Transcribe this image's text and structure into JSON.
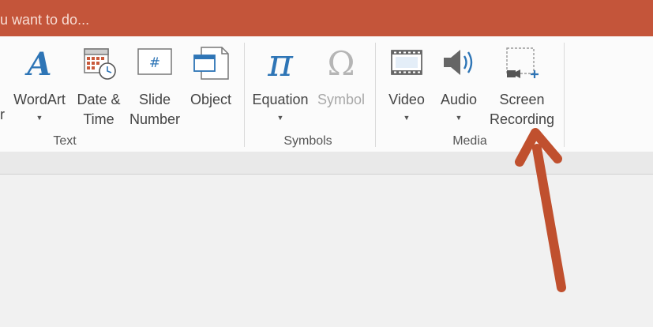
{
  "titlebar": {
    "tell_me": "u want to do..."
  },
  "ribbon": {
    "partial_label": "r",
    "buttons": {
      "wordart": {
        "label": "WordArt"
      },
      "datetime": {
        "line1": "Date &",
        "line2": "Time"
      },
      "slide_number": {
        "line1": "Slide",
        "line2": "Number"
      },
      "object": {
        "label": "Object"
      },
      "equation": {
        "label": "Equation"
      },
      "symbol": {
        "label": "Symbol"
      },
      "video": {
        "label": "Video"
      },
      "audio": {
        "label": "Audio"
      },
      "screen_recording": {
        "line1": "Screen",
        "line2": "Recording"
      }
    },
    "groups": {
      "text": "Text",
      "symbols": "Symbols",
      "media": "Media"
    },
    "icon_glyphs": {
      "pi": "π",
      "omega": "Ω",
      "hash": "#"
    }
  },
  "colors": {
    "titlebar": "#c4553a",
    "accent_blue": "#2e75b6",
    "arrow": "#c0502e"
  },
  "icons": [
    "wordart-icon",
    "calendar-clock-icon",
    "slide-number-icon",
    "object-icon",
    "pi-icon",
    "omega-icon",
    "film-icon",
    "speaker-icon",
    "screen-recording-icon"
  ]
}
